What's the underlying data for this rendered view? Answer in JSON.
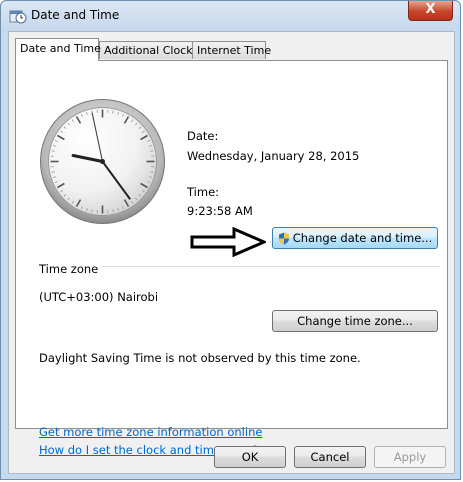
{
  "window": {
    "title": "Date and Time",
    "icon": "date-time-control-panel-icon",
    "close_label": "X"
  },
  "tabs": [
    {
      "label": "Date and Time",
      "active": true
    },
    {
      "label": "Additional Clocks",
      "active": false
    },
    {
      "label": "Internet Time",
      "active": false
    }
  ],
  "date_section": {
    "date_label": "Date:",
    "date_value": "Wednesday, January 28, 2015",
    "time_label": "Time:",
    "time_value": "9:23:58 AM",
    "change_button": "Change date and time..."
  },
  "timezone_section": {
    "heading": "Time zone",
    "value": "(UTC+03:00) Nairobi",
    "change_button": "Change time zone...",
    "dst_note": "Daylight Saving Time is not observed by this time zone."
  },
  "links": {
    "more_info": "Get more time zone information online",
    "how_to": "How do I set the clock and time zone?"
  },
  "footer": {
    "ok": "OK",
    "cancel": "Cancel",
    "apply": "Apply"
  },
  "clock": {
    "hours": 9,
    "minutes": 23,
    "seconds": 58
  },
  "colors": {
    "link": "#0066cc",
    "title_bar": "#c6d8ec",
    "close_button": "#c8452b"
  }
}
